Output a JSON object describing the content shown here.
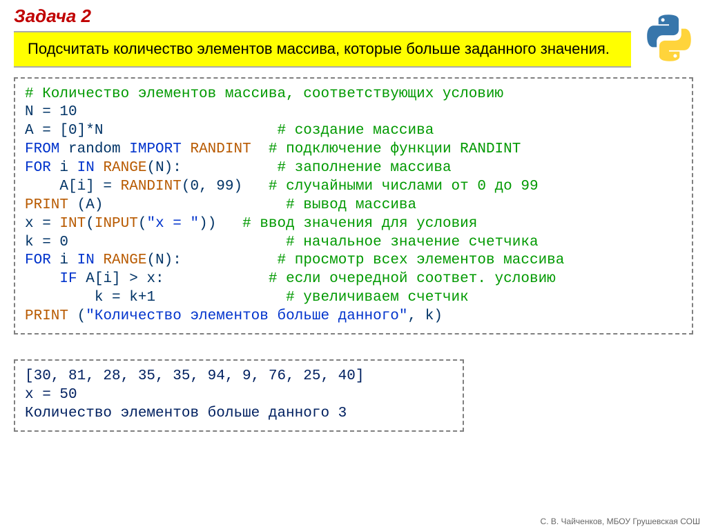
{
  "title": "Задача 2",
  "task_description": "Подсчитать количество элементов массива, которые больше заданного значения.",
  "code": {
    "l1_comment": "# Количество элементов массива, соответствующих условию",
    "l2_lhs": "N",
    "l2_op": " = ",
    "l2_rhs": "10",
    "l3_lhs": "A",
    "l3_op": " = ",
    "l3_rhs_open": "[",
    "l3_rhs_zero": "0",
    "l3_rhs_close": "]*N",
    "l3_comment": "# создание массива",
    "l4_from": "FROM",
    "l4_random": " random ",
    "l4_import": "IMPORT",
    "l4_randint": " RANDINT",
    "l4_comment": "  # подключение функции RANDINT",
    "l5_for": "FOR",
    "l5_i": " i ",
    "l5_in": "IN",
    "l5_range": " RANGE",
    "l5_paren": "(N):",
    "l5_comment": "# заполнение массива",
    "l6_indent": "    A[i] = ",
    "l6_randint": "RANDINT",
    "l6_args": "(",
    "l6_a0": "0",
    "l6_sep": ", ",
    "l6_a1": "99",
    "l6_close": ")",
    "l6_comment": "   # случайными числами от 0 до 99",
    "l7_print": "PRINT",
    "l7_args": " (A)",
    "l7_comment": "# вывод массива",
    "l8_lhs": "x = ",
    "l8_int": "INT",
    "l8_open": "(",
    "l8_input": "INPUT",
    "l8_arg_open": "(",
    "l8_str": "\"x = \"",
    "l8_close": "))",
    "l8_comment": "   # ввод значения для условия",
    "l9_lhs": "k = ",
    "l9_val": "0",
    "l9_comment": "# начальное значение счетчика",
    "l10_for": "FOR",
    "l10_i": " i ",
    "l10_in": "IN",
    "l10_range": " RANGE",
    "l10_paren": "(N):",
    "l10_comment": "# просмотр всех элементов массива",
    "l11_indent": "    ",
    "l11_if": "IF",
    "l11_cond": " A[i] > x:",
    "l11_comment": "# если очередной соответ. условию",
    "l12_body": "        k = k+",
    "l12_one": "1",
    "l12_comment": "# увеличиваем счетчик",
    "l13_print": "PRINT",
    "l13_open": " (",
    "l13_str": "\"Количество элементов больше данного\"",
    "l13_rest": ", k)"
  },
  "output": {
    "array": "[30, 81, 28, 35, 35, 94, 9, 76, 25, 40]",
    "prompt": "x = 50",
    "result": "Количество элементов больше данного 3"
  },
  "footer": "С. В. Чайченков, МБОУ Грушевская СОШ"
}
